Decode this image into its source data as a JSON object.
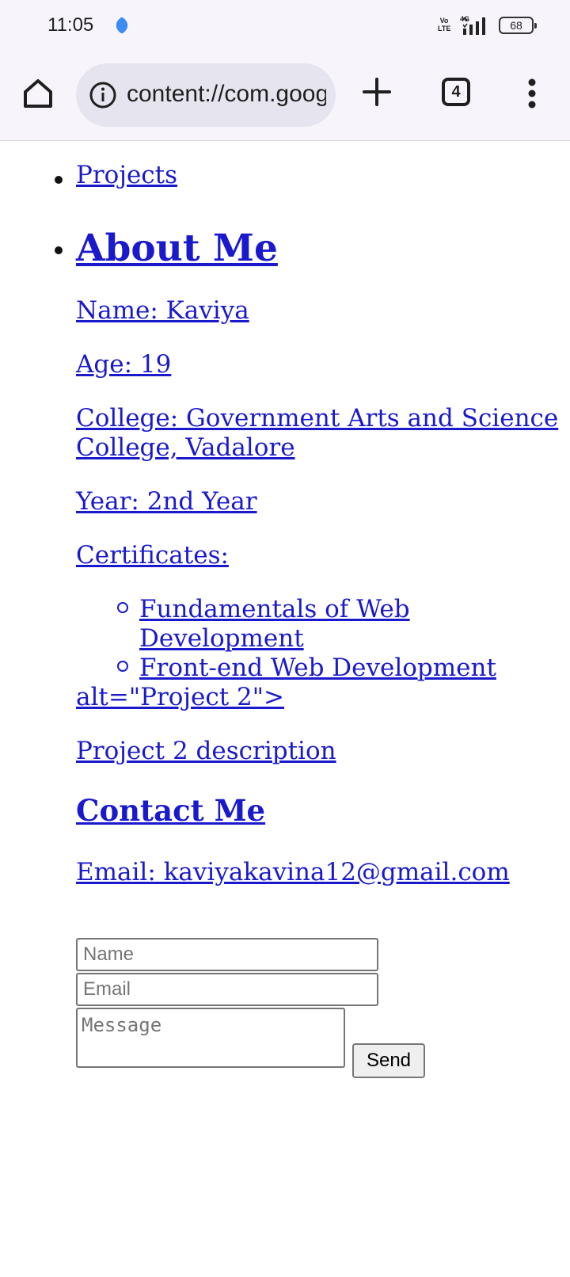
{
  "status_bar": {
    "time": "11:05",
    "volte": "Vo\nLTE",
    "network": "4G",
    "battery": "68"
  },
  "browser": {
    "url": "content://com.google.android.apps.nbu.files.provider",
    "tab_count": "4"
  },
  "page": {
    "nav": {
      "projects_link": "Projects"
    },
    "about": {
      "heading": "About Me",
      "name": "Name: Kaviya",
      "age": "Age: 19",
      "college_line1": "College: Government Arts and Science",
      "college_line2": "College, Vadalore",
      "year": "Year: 2nd Year",
      "certificates_label": "Certificates:",
      "certificates": [
        {
          "line1": "Fundamentals of Web",
          "line2": "Development"
        },
        {
          "line1": "Front-end Web Development"
        }
      ],
      "stray_text": "alt=\"Project 2\">",
      "project_description": "Project 2 description"
    },
    "contact": {
      "heading": "Contact Me",
      "email": "Email: kaviyakavina12@gmail.com",
      "name_placeholder": "Name",
      "email_placeholder": "Email",
      "message_placeholder": "Message",
      "send_label": "Send"
    }
  }
}
